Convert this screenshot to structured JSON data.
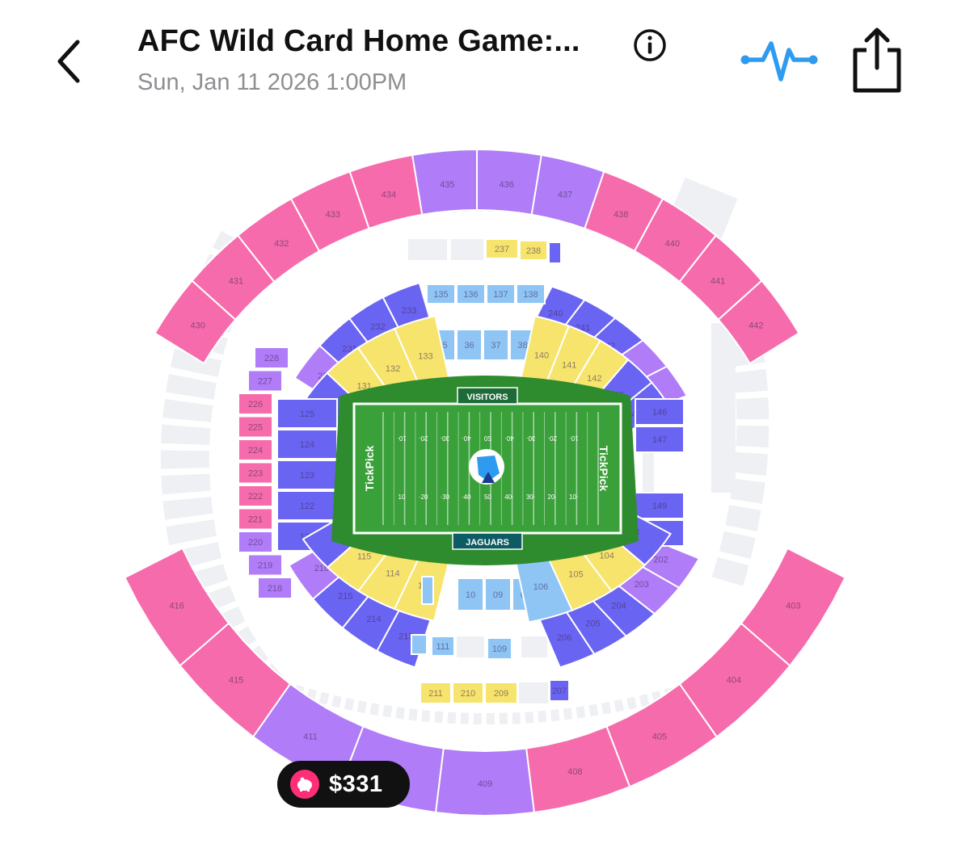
{
  "header": {
    "title": "AFC Wild Card Home Game:...",
    "date": "Sun, Jan 11 2026 1:00PM"
  },
  "colors": {
    "pink": "#f66bab",
    "lavender": "#b07cf7",
    "indigo": "#6a64f2",
    "light_blue": "#8ec5f5",
    "yellow": "#f6e46c",
    "unavailable": "#eef0f4",
    "field_green": "#2e8b2e",
    "field_inner": "#3aa03a",
    "accent_blue": "#2e9bf0",
    "price_pill": "#111111",
    "pig_pink": "#ff2e78"
  },
  "field": {
    "top_label": "VISITORS",
    "bottom_label": "JAGUARS",
    "endzone_left": "TickPick",
    "endzone_right": "TickPick",
    "top_yardlines": [
      "10·",
      "20·",
      "30·",
      "40·",
      "50",
      "40·",
      "30·",
      "20·",
      "10·"
    ],
    "bottom_yardlines": [
      "10",
      "·20",
      "·30",
      "·40",
      "50",
      "40·",
      "30·",
      "20·",
      "10·"
    ]
  },
  "sections": {
    "upper_north": [
      "430",
      "431",
      "432",
      "433",
      "434",
      "435",
      "436",
      "437",
      "438",
      "440",
      "441",
      "442"
    ],
    "upper_south": [
      "416",
      "415",
      "411",
      "410",
      "409",
      "408",
      "405",
      "404",
      "403"
    ],
    "club_north_left": [
      "230",
      "231",
      "232",
      "233"
    ],
    "club_north_right": [
      "240",
      "241",
      "242",
      "243",
      "244"
    ],
    "club_west": [
      "228",
      "227",
      "226",
      "225",
      "224",
      "223",
      "222",
      "221",
      "220",
      "219",
      "218"
    ],
    "club_south_left": [
      "216",
      "215",
      "214",
      "213"
    ],
    "club_south_right": [
      "206",
      "205",
      "204",
      "203",
      "202"
    ],
    "club_center_north": [
      "237",
      "238"
    ],
    "club_center_south": [
      "211",
      "210",
      "209",
      "207"
    ],
    "lower_north_inner": [
      "135",
      "136",
      "137",
      "138"
    ],
    "lower_north_field": [
      "35",
      "36",
      "37",
      "38"
    ],
    "lower_north_left": [
      "130",
      "131",
      "132",
      "133"
    ],
    "lower_north_right": [
      "140",
      "141",
      "142",
      "143",
      "144"
    ],
    "lower_west": [
      "125",
      "124",
      "123",
      "122",
      "121"
    ],
    "lower_east": [
      "146",
      "147",
      "149",
      "150"
    ],
    "lower_south_left": [
      "116",
      "115",
      "114",
      "113"
    ],
    "lower_south_field": [
      "10",
      "09",
      "08"
    ],
    "lower_south_right": [
      "106",
      "105",
      "104",
      "103"
    ],
    "lower_south_inner": [
      "111",
      "109"
    ]
  },
  "price_pill": {
    "amount": "$331"
  }
}
